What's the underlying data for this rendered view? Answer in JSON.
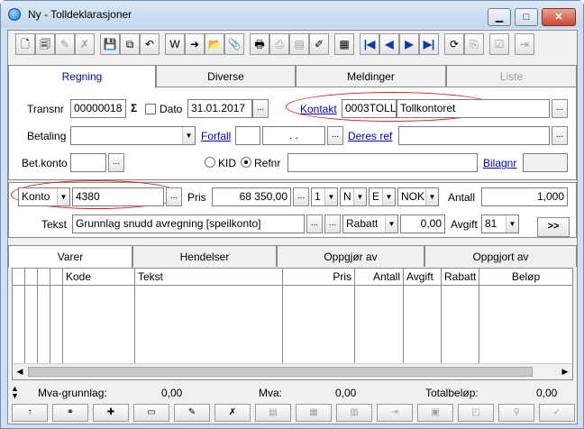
{
  "window": {
    "title": "Ny - Tolldeklarasjoner",
    "minimize_glyph": "▁",
    "maximize_glyph": "□",
    "close_glyph": "✕"
  },
  "toolbar": [
    {
      "name": "new-doc-icon",
      "glyph": "🗋"
    },
    {
      "name": "copy-doc-icon",
      "glyph": "🗐"
    },
    {
      "name": "edit-doc-icon",
      "glyph": "✎"
    },
    {
      "name": "delete-doc-icon",
      "glyph": "✗"
    },
    {
      "name": "save-icon",
      "glyph": "💾"
    },
    {
      "name": "copy-icon",
      "glyph": "⧉"
    },
    {
      "name": "undo-icon",
      "glyph": "↶"
    },
    {
      "name": "word-export-icon",
      "glyph": "W"
    },
    {
      "name": "export-icon",
      "glyph": "➜"
    },
    {
      "name": "open-folder-icon",
      "glyph": "📂"
    },
    {
      "name": "attachment-icon",
      "glyph": "📎"
    },
    {
      "name": "print-icon",
      "glyph": "🖶"
    },
    {
      "name": "print-preview-icon",
      "glyph": "⎙"
    },
    {
      "name": "print-setup-icon",
      "glyph": "▤"
    },
    {
      "name": "tools-icon",
      "glyph": "✐"
    },
    {
      "name": "calculator-icon",
      "glyph": "▦"
    },
    {
      "name": "first-record-icon",
      "glyph": "|◀"
    },
    {
      "name": "previous-record-icon",
      "glyph": "◀"
    },
    {
      "name": "next-record-icon",
      "glyph": "▶"
    },
    {
      "name": "last-record-icon",
      "glyph": "▶|"
    },
    {
      "name": "refresh-icon",
      "glyph": "⟳"
    },
    {
      "name": "copy-record-icon",
      "glyph": "⎘"
    },
    {
      "name": "approve-icon",
      "glyph": "☑"
    },
    {
      "name": "exit-icon",
      "glyph": "⇥"
    }
  ],
  "tabs": [
    "Regning",
    "Diverse",
    "Meldinger",
    "Liste"
  ],
  "form": {
    "transnr_label": "Transnr",
    "transnr_value": "00000018",
    "sigma": "Σ",
    "dato_label": "Dato",
    "dato_value": "31.01.2017",
    "kontakt_label": "Kontakt",
    "kontakt_code": "0003TOLL",
    "kontakt_name": "Tollkontoret",
    "betaling_label": "Betaling",
    "betaling_value": "",
    "forfall_label": "Forfall",
    "forfall_value": ". .",
    "deres_ref_label": "Deres ref",
    "deres_ref_value": "",
    "betkonto_label": "Bet.konto",
    "betkonto_value": "",
    "kid_label": "KID",
    "refnr_label": "Refnr",
    "refnr_value": "",
    "bilagnr_label": "Bilagnr",
    "bilagnr_value": "",
    "konto_type": "Konto",
    "konto_value": "4380",
    "pris_label": "Pris",
    "pris_value": "68 350,00",
    "code1": "1",
    "code2": "N",
    "code3": "E",
    "currency": "NOK",
    "antall_label": "Antall",
    "antall_value": "1,000",
    "tekst_label": "Tekst",
    "tekst_value": "Grunnlag snudd avregning [speilkonto]",
    "rabatt_label": "Rabatt",
    "rabatt_value": "0,00",
    "avgift_label": "Avgift",
    "avgift_value": "81",
    "more_button": ">>",
    "ellipsis": "..."
  },
  "bottom_tabs": [
    "Varer",
    "Hendelser",
    "Oppgjør av",
    "Oppgjort av"
  ],
  "grid_columns": [
    "Kode",
    "Tekst",
    "Pris",
    "Antall",
    "Avgift",
    "Rabatt",
    "Beløp"
  ],
  "totals": {
    "mva_grunnlag_label": "Mva-grunnlag:",
    "mva_grunnlag_value": "0,00",
    "mva_label": "Mva:",
    "mva_value": "0,00",
    "total_label": "Totalbeløp:",
    "total_value": "0,00"
  },
  "bottom_buttons": [
    {
      "name": "move-up-button",
      "glyph": "↑"
    },
    {
      "name": "link-button",
      "glyph": "⚭"
    },
    {
      "name": "add-line-button",
      "glyph": "✚"
    },
    {
      "name": "insert-line-button",
      "glyph": "▭"
    },
    {
      "name": "edit-line-button",
      "glyph": "✎"
    },
    {
      "name": "delete-line-button",
      "glyph": "✗"
    },
    {
      "name": "line-action-7-button",
      "glyph": "▤"
    },
    {
      "name": "line-action-8-button",
      "glyph": "▦"
    },
    {
      "name": "line-action-9-button",
      "glyph": "▥"
    },
    {
      "name": "line-action-10-button",
      "glyph": "⇥"
    },
    {
      "name": "line-action-11-button",
      "glyph": "▣"
    },
    {
      "name": "line-action-12-button",
      "glyph": "◰"
    },
    {
      "name": "line-action-13-button",
      "glyph": "⚲"
    },
    {
      "name": "line-action-14-button",
      "glyph": "✓"
    }
  ]
}
